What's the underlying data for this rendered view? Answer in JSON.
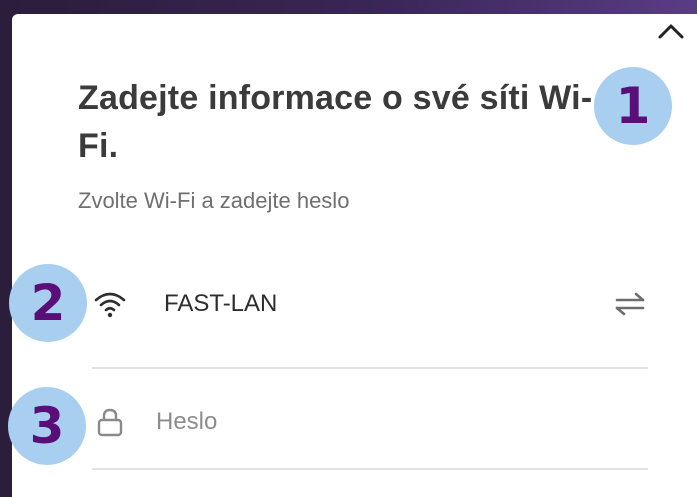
{
  "dialog": {
    "title": "Zadejte informace o své síti Wi-Fi.",
    "subtitle": "Zvolte Wi-Fi a zadejte heslo"
  },
  "network": {
    "ssid": "FAST-LAN",
    "password_placeholder": "Heslo",
    "password_value": ""
  },
  "badges": [
    "1",
    "2",
    "3"
  ],
  "icons": {
    "close": "close-chevron-icon",
    "wifi": "wifi-icon",
    "swap": "swap-arrows-icon",
    "lock": "lock-icon"
  },
  "colors": {
    "badge_fill": "#a9cff0",
    "badge_text": "#5a0f78",
    "backdrop": "#3b2656"
  }
}
